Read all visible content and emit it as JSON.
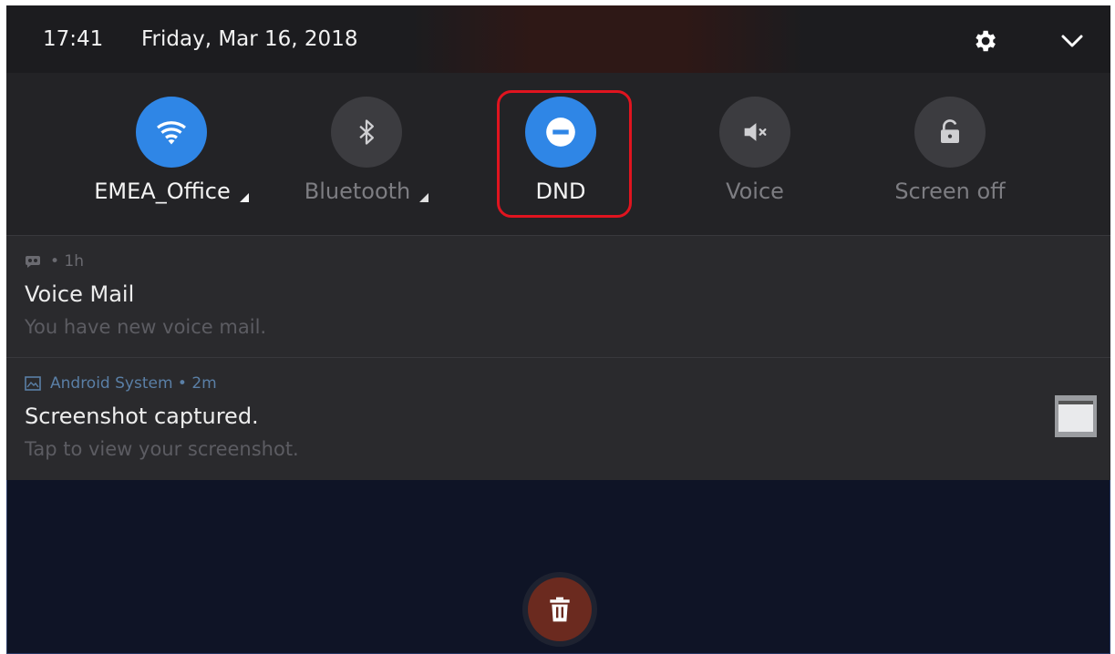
{
  "status_bar": {
    "time": "17:41",
    "date": "Friday, Mar 16, 2018",
    "settings_icon": "gear-icon",
    "expand_icon": "chevron-down-icon"
  },
  "quick_settings": [
    {
      "id": "wifi",
      "label": "EMEA_Office",
      "icon": "wifi-icon",
      "active": true,
      "has_dropdown": true
    },
    {
      "id": "bluetooth",
      "label": "Bluetooth",
      "icon": "bluetooth-icon",
      "active": false,
      "has_dropdown": true
    },
    {
      "id": "dnd",
      "label": "DND",
      "icon": "do-not-disturb-icon",
      "active": true,
      "has_dropdown": false,
      "highlighted": true
    },
    {
      "id": "voice",
      "label": "Voice",
      "icon": "volume-mute-icon",
      "active": false,
      "has_dropdown": false
    },
    {
      "id": "screen_off",
      "label": "Screen off",
      "icon": "lock-icon",
      "active": false,
      "has_dropdown": false
    }
  ],
  "notifications": [
    {
      "app_icon": "voicemail-icon",
      "app": "",
      "age": "• 1h",
      "title": "Voice Mail",
      "body": "You have new voice mail."
    },
    {
      "app_icon": "image-icon",
      "app": "Android System",
      "age": " • 2m",
      "title": "Screenshot captured.",
      "body": "Tap to view your screenshot."
    }
  ],
  "clear_all_icon": "trash-icon",
  "colors": {
    "accent": "#2f86e6",
    "highlight_border": "#e0141f",
    "panel": "#232326",
    "background": "#0f1426"
  }
}
